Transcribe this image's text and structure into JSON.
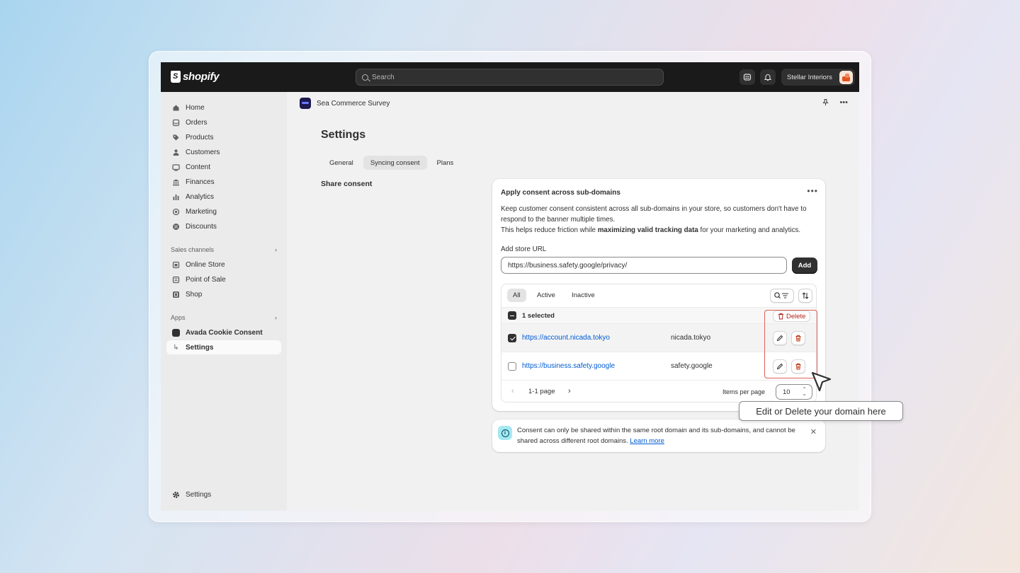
{
  "topbar": {
    "logo_text": "shopify",
    "search_placeholder": "Search",
    "store_name": "Stellar Interiors"
  },
  "sidebar": {
    "items": [
      {
        "label": "Home",
        "icon": "home-icon"
      },
      {
        "label": "Orders",
        "icon": "inbox-icon"
      },
      {
        "label": "Products",
        "icon": "tag-icon"
      },
      {
        "label": "Customers",
        "icon": "person-icon"
      },
      {
        "label": "Content",
        "icon": "content-icon"
      },
      {
        "label": "Finances",
        "icon": "bank-icon"
      },
      {
        "label": "Analytics",
        "icon": "bar-chart-icon"
      },
      {
        "label": "Marketing",
        "icon": "target-icon"
      },
      {
        "label": "Discounts",
        "icon": "discount-icon"
      }
    ],
    "sales_channels_label": "Sales channels",
    "channels": [
      {
        "label": "Online Store",
        "icon": "store-icon"
      },
      {
        "label": "Point of Sale",
        "icon": "pos-icon"
      },
      {
        "label": "Shop",
        "icon": "shop-icon"
      }
    ],
    "apps_label": "Apps",
    "app_name": "Avada Cookie Consent",
    "app_sub": "Settings",
    "settings_label": "Settings"
  },
  "app_header": {
    "title": "Sea Commerce Survey"
  },
  "page": {
    "title": "Settings",
    "tabs": [
      "General",
      "Syncing consent",
      "Plans"
    ],
    "active_tab": "Syncing consent",
    "section_label": "Share consent"
  },
  "card": {
    "title": "Apply consent across sub-domains",
    "desc_line1": "Keep customer consent consistent across all sub-domains in your store, so customers don't have to respond to the banner multiple times.",
    "desc_line2_pre": "This helps reduce friction while ",
    "desc_line2_bold": "maximizing valid tracking data",
    "desc_line2_post": " for your marketing and analytics.",
    "url_label": "Add store URL",
    "url_value": "https://business.safety.google/privacy/",
    "add_label": "Add"
  },
  "table": {
    "filters": [
      "All",
      "Active",
      "Inactive"
    ],
    "active_filter": "All",
    "selected_text": "1 selected",
    "delete_label": "Delete",
    "rows": [
      {
        "url": "https://account.nicada.tokyo",
        "domain": "nicada.tokyo",
        "checked": true
      },
      {
        "url": "https://business.safety.google",
        "domain": "safety.google",
        "checked": false
      }
    ],
    "page_text": "1-1 page",
    "items_per_page_label": "Items per page",
    "items_per_page": "10"
  },
  "tooltip": {
    "text": "Edit or Delete your domain here"
  },
  "banner": {
    "text": "Consent can only be shared within the same root domain and its sub-domains, and cannot be shared across different root domains. ",
    "link": "Learn more"
  }
}
